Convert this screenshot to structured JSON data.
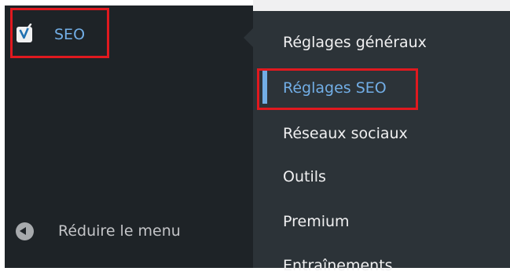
{
  "colors": {
    "sidebar_bg": "#1e2327",
    "flyout_bg": "#2c3338",
    "accent": "#72aee6",
    "highlight_border": "#e0191f",
    "text": "#f0f0f1"
  },
  "sidebar": {
    "seo": {
      "icon": "yoast-icon",
      "label": "SEO"
    },
    "collapse": {
      "icon": "collapse-arrow-icon",
      "label": "Réduire le menu"
    }
  },
  "submenu": {
    "items": [
      {
        "label": "Réglages généraux",
        "active": false
      },
      {
        "label": "Réglages SEO",
        "active": true
      },
      {
        "label": "Réseaux sociaux",
        "active": false
      },
      {
        "label": "Outils",
        "active": false
      },
      {
        "label": "Premium",
        "active": false
      },
      {
        "label": "Entraînements",
        "active": false
      }
    ]
  }
}
